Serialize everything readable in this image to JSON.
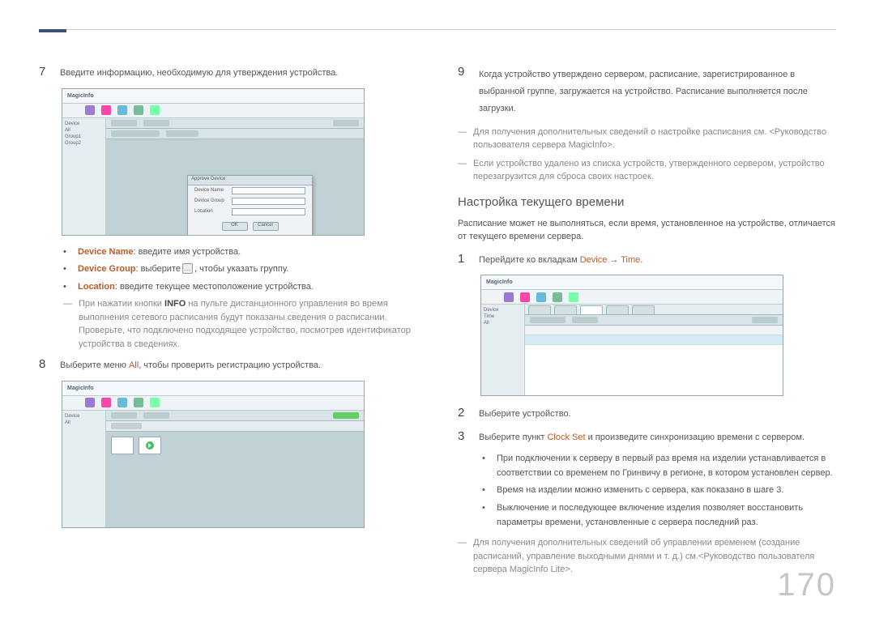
{
  "pageNumber": "170",
  "left": {
    "step7": {
      "num": "7",
      "text": "Введите информацию, необходимую для утверждения устройства."
    },
    "screenshot1": {
      "logo": "MagicInfo",
      "dialogTitle": "Approve Device",
      "fields": {
        "deviceName": {
          "label": "Device Name"
        },
        "deviceGroup": {
          "label": "Device Group"
        },
        "location": {
          "label": "Location"
        }
      },
      "buttons": {
        "ok": "OK",
        "cancel": "Cancel"
      }
    },
    "bullets7": {
      "b1": {
        "label": "Device Name",
        "text": ": введите имя устройства."
      },
      "b2": {
        "label": "Device Group",
        "text_before": ": выберите",
        "text_after": ", чтобы указать группу."
      },
      "b3": {
        "label": "Location",
        "text": ": введите текущее местоположение устройства."
      }
    },
    "note7": {
      "text_before": "При нажатии кнопки ",
      "info": "INFO",
      "text_after": " на пульте дистанционного управления во время выполнения сетевого расписания будут показаны сведения о расписании. Проверьте, что подключено подходящее устройство, посмотрев идентификатор устройства в сведениях."
    },
    "step8": {
      "num": "8",
      "text_before": "Выберите меню ",
      "all": "All",
      "text_after": ", чтобы проверить регистрацию устройства."
    },
    "screenshot2": {
      "logo": "MagicInfo"
    }
  },
  "right": {
    "step9": {
      "num": "9",
      "text": "Когда устройство утверждено сервером, расписание, зарегистрированное в выбранной группе, загружается на устройство. Расписание выполняется после загрузки."
    },
    "note9a": "Для получения дополнительных сведений о настройке расписания см. <Руководство пользователя сервера MagicInfo>.",
    "note9b": "Если устройство удалено из списка устройств, утвержденного сервером, устройство перезагрузится для сброса своих настроек.",
    "heading": "Настройка текущего времени",
    "intro": "Расписание может не выполняться, если время, установленное на устройстве, отличается от текущего времени сервера.",
    "step1": {
      "num": "1",
      "text_before": "Перейдите ко вкладкам ",
      "device": "Device",
      "arrow": " → ",
      "time": "Time",
      "text_after": "."
    },
    "screenshot3": {
      "logo": "MagicInfo"
    },
    "step2": {
      "num": "2",
      "text": "Выберите устройство."
    },
    "step3": {
      "num": "3",
      "text_before": "Выберите пункт ",
      "clockset": "Clock Set",
      "text_after": " и произведите синхронизацию времени с сервером."
    },
    "bullets3": {
      "b1": "При подключении к серверу в первый раз время на изделии устанавливается в соответствии со временем по Гринвичу в регионе, в котором установлен сервер.",
      "b2": "Время на изделии можно изменить с сервера, как показано в шаге 3.",
      "b3": "Выключение и последующее включение изделия позволяет восстановить параметры времени, установленные с сервера последний раз."
    },
    "note3": "Для получения дополнительных сведений об управлении временем (создание расписаний, управление выходными днями и т. д.) см.<Руководство пользователя сервера MagicInfo Lite>."
  },
  "icons": {
    "groupBtn": "…"
  }
}
